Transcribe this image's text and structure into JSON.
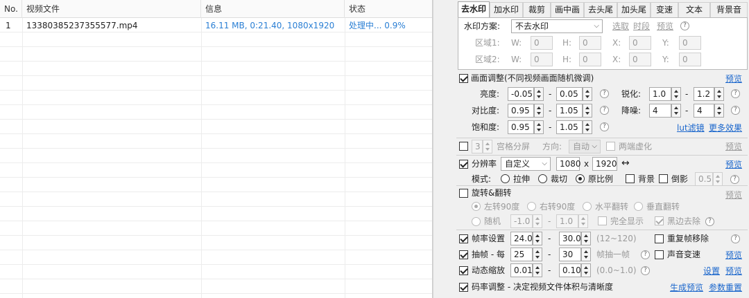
{
  "file_list": {
    "columns": {
      "no": "No.",
      "file": "视频文件",
      "info": "信息",
      "status": "状态"
    },
    "rows": [
      {
        "no": "1",
        "file": "13380385237355577.mp4",
        "info": "16.11 MB, 0:21.40, 1080x1920",
        "status": "处理中... 0.9%"
      }
    ]
  },
  "tabs": [
    "去水印",
    "加水印",
    "裁剪",
    "画中画",
    "去头尾",
    "加头尾",
    "变速",
    "文本",
    "背景音"
  ],
  "watermark": {
    "scheme_label": "水印方案:",
    "scheme_value": "不去水印",
    "links": [
      "选取",
      "时段",
      "预览"
    ],
    "help": "?",
    "area1_label": "区域1:",
    "area2_label": "区域2:",
    "fields": {
      "w": "W:",
      "h": "H:",
      "x": "X:",
      "y": "Y:"
    },
    "value": "0"
  },
  "picture_adjust": {
    "label": "画面调整(不同视频画面随机微调)",
    "preview": "预览",
    "brightness_label": "亮度:",
    "brightness": [
      "-0.05",
      "0.05"
    ],
    "contrast_label": "对比度:",
    "contrast": [
      "0.95",
      "1.05"
    ],
    "saturation_label": "饱和度:",
    "saturation": [
      "0.95",
      "1.05"
    ],
    "sharpen_label": "锐化:",
    "sharpen": [
      "1.0",
      "1.2"
    ],
    "denoise_label": "降噪:",
    "denoise": [
      "4",
      "4"
    ],
    "lut_link": "lut滤镜",
    "more_link": "更多效果",
    "dash": "-"
  },
  "grid_split": {
    "value": "3",
    "label": "宫格分屏",
    "dir_label": "方向:",
    "dir_value": "自动",
    "blur_label": "两端虚化",
    "preview": "预览"
  },
  "resolution": {
    "label": "分辨率",
    "preset": "自定义",
    "width": "1080",
    "x": "x",
    "height": "1920",
    "swap": "↔",
    "preview": "预览",
    "mode_label": "模式:",
    "modes": [
      "拉伸",
      "裁切",
      "原比例"
    ],
    "background_label": "背景",
    "shadow_label": "倒影",
    "shadow_value": "0.5"
  },
  "rotate": {
    "label": "旋转&翻转",
    "preview": "预览",
    "options": [
      "左转90度",
      "右转90度",
      "水平翻转",
      "垂直翻转"
    ],
    "random_label": "随机",
    "random_min": "-1.0",
    "random_max": "1.0",
    "full_show": "完全显示",
    "black_remove": "黑边去除"
  },
  "framerate": {
    "label": "帧率设置",
    "min": "24.0",
    "max": "30.0",
    "range_hint": "(12~120)",
    "dup_label": "重复帧移除"
  },
  "frame_drop": {
    "label": "抽帧 - 每",
    "every": "25",
    "frames": "30",
    "unit": "帧抽一帧",
    "audio_label": "声音变速",
    "preview": "预览"
  },
  "dyn_zoom": {
    "label": "动态缩放",
    "min": "0.01",
    "max": "0.10",
    "range_hint": "(0.0~1.0)",
    "settings": "设置",
    "preview": "预览"
  },
  "bitrate": {
    "label": "码率调整 - 决定视频文件体积与清晰度",
    "gen_preview": "生成预览",
    "params_reset": "参数重置"
  },
  "colors": {
    "link": "#1a66cc",
    "info_text": "#2a7fd4",
    "status_text": "#2a7fd4"
  }
}
